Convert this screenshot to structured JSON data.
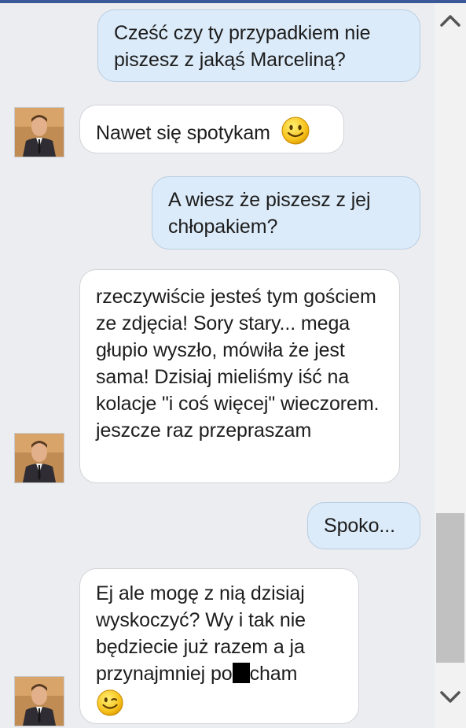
{
  "messages": [
    {
      "id": "m1",
      "side": "out",
      "text": "Cześć czy ty przypadkiem nie piszesz z jakąś Marceliną?"
    },
    {
      "id": "m2",
      "side": "in",
      "text": "Nawet się spotykam",
      "emoji": "smile-emoji"
    },
    {
      "id": "m3",
      "side": "out",
      "text": "A wiesz że piszesz z jej chłopakiem?"
    },
    {
      "id": "m4",
      "side": "in",
      "text": "rzeczywiście jesteś tym gościem ze zdjęcia! Sory stary... mega głupio wyszło, mówiła że jest sama! Dzisiaj mieliśmy iść na kolacje \"i coś więcej\" wieczorem. jeszcze raz przepraszam"
    },
    {
      "id": "m5",
      "side": "out",
      "text": "Spoko..."
    },
    {
      "id": "m6",
      "side": "in",
      "text_before": "Ej ale mogę z nią dzisiaj wyskoczyć? Wy i tak nie będziecie już razem a ja przynajmniej po",
      "text_after": "cham",
      "redacted": true,
      "emoji": "wink-emoji"
    }
  ],
  "icons": {
    "scroll_up": "chevron-up-icon",
    "scroll_down": "chevron-down-icon",
    "avatar": "user-avatar"
  },
  "colors": {
    "outgoing_bubble": "#dcebf9",
    "incoming_bubble": "#ffffff",
    "background": "#ecedf0",
    "scroll_thumb": "#c1c1c1"
  }
}
